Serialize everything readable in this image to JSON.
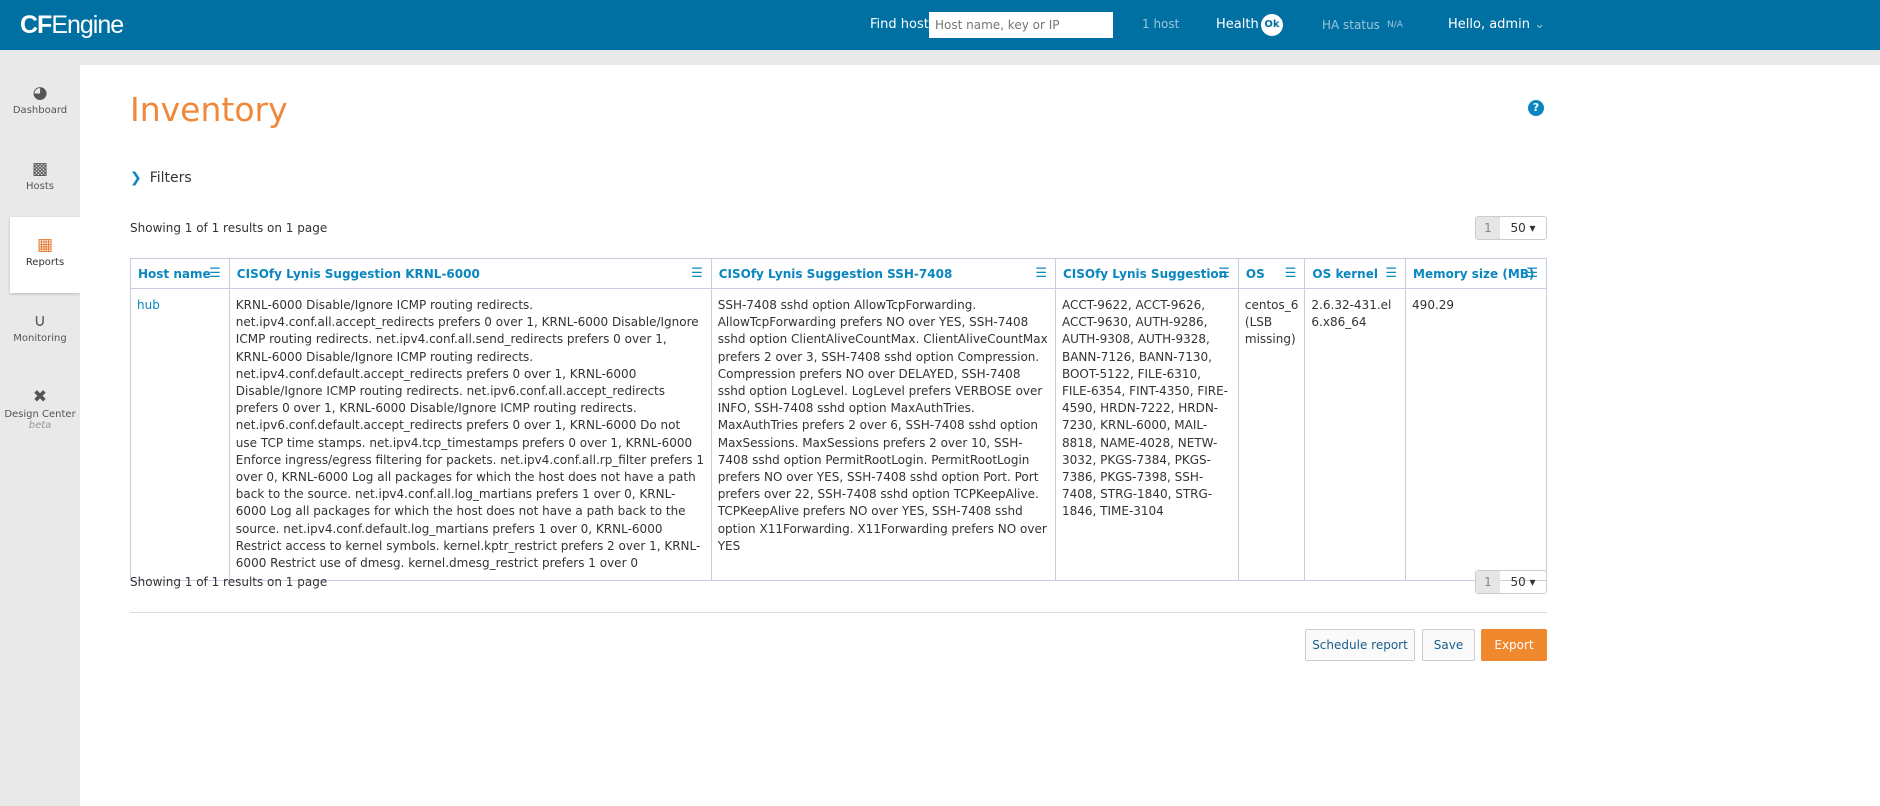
{
  "header": {
    "logo": "CFEngine",
    "find_label": "Find host:",
    "search_placeholder": "Host name, key or IP",
    "host_count": "1 host",
    "health_label": "Health",
    "health_status": "Ok",
    "ha_label": "HA status",
    "ha_value": "N/A",
    "greeting": "Hello, admin"
  },
  "sidebar": {
    "items": [
      {
        "label": "Dashboard",
        "icon": "gauge-icon"
      },
      {
        "label": "Hosts",
        "icon": "hierarchy-icon"
      },
      {
        "label": "Reports",
        "icon": "table-icon",
        "active": true
      },
      {
        "label": "Monitoring",
        "icon": "stethoscope-icon"
      },
      {
        "label": "Design Center",
        "sub": "beta",
        "icon": "tools-icon"
      }
    ]
  },
  "page": {
    "title": "Inventory",
    "filters": "Filters",
    "showing": "Showing 1 of 1 results on 1 page",
    "page": "1",
    "per_page": "50"
  },
  "table": {
    "headers": [
      "Host name",
      "CISOfy Lynis Suggestion KRNL-6000",
      "CISOfy Lynis Suggestion SSH-7408",
      "CISOfy Lynis Suggestion",
      "OS",
      "OS kernel",
      "Memory size (MB)"
    ],
    "rows": [
      [
        "hub",
        "KRNL-6000 Disable/Ignore ICMP routing redirects. net.ipv4.conf.all.accept_redirects prefers 0 over 1, KRNL-6000 Disable/Ignore ICMP routing redirects. net.ipv4.conf.all.send_redirects prefers 0 over 1, KRNL-6000 Disable/Ignore ICMP routing redirects. net.ipv4.conf.default.accept_redirects prefers 0 over 1, KRNL-6000 Disable/Ignore ICMP routing redirects. net.ipv6.conf.all.accept_redirects prefers 0 over 1, KRNL-6000 Disable/Ignore ICMP routing redirects. net.ipv6.conf.default.accept_redirects prefers 0 over 1, KRNL-6000 Do not use TCP time stamps. net.ipv4.tcp_timestamps prefers 0 over 1, KRNL-6000 Enforce ingress/egress filtering for packets. net.ipv4.conf.all.rp_filter prefers 1 over 0, KRNL-6000 Log all packages for which the host does not have a path back to the source. net.ipv4.conf.all.log_martians prefers 1 over 0, KRNL-6000 Log all packages for which the host does not have a path back to the source. net.ipv4.conf.default.log_martians prefers 1 over 0, KRNL-6000 Restrict access to kernel symbols. kernel.kptr_restrict prefers 2 over 1, KRNL-6000 Restrict use of dmesg. kernel.dmesg_restrict prefers 1 over 0",
        "SSH-7408 sshd option AllowTcpForwarding. AllowTcpForwarding prefers NO over YES, SSH-7408 sshd option ClientAliveCountMax. ClientAliveCountMax prefers 2 over 3, SSH-7408 sshd option Compression. Compression prefers NO over DELAYED, SSH-7408 sshd option LogLevel. LogLevel prefers VERBOSE over INFO, SSH-7408 sshd option MaxAuthTries. MaxAuthTries prefers 2 over 6, SSH-7408 sshd option MaxSessions. MaxSessions prefers 2 over 10, SSH-7408 sshd option PermitRootLogin. PermitRootLogin prefers NO over YES, SSH-7408 sshd option Port. Port prefers over 22, SSH-7408 sshd option TCPKeepAlive. TCPKeepAlive prefers NO over YES, SSH-7408 sshd option X11Forwarding. X11Forwarding prefers NO over YES",
        "ACCT-9622, ACCT-9626, ACCT-9630, AUTH-9286, AUTH-9308, AUTH-9328, BANN-7126, BANN-7130, BOOT-5122, FILE-6310, FILE-6354, FINT-4350, FIRE-4590, HRDN-7222, HRDN-7230, KRNL-6000, MAIL-8818, NAME-4028, NETW-3032, PKGS-7384, PKGS-7386, PKGS-7398, SSH-7408, STRG-1840, STRG-1846, TIME-3104",
        "centos_6 (LSB missing)",
        "2.6.32-431.el6.x86_64",
        "490.29"
      ]
    ]
  },
  "actions": {
    "schedule": "Schedule report",
    "save": "Save",
    "export": "Export"
  },
  "colors": {
    "header": "#0070a3",
    "accent": "#f0883a",
    "link": "#0a86c0"
  }
}
